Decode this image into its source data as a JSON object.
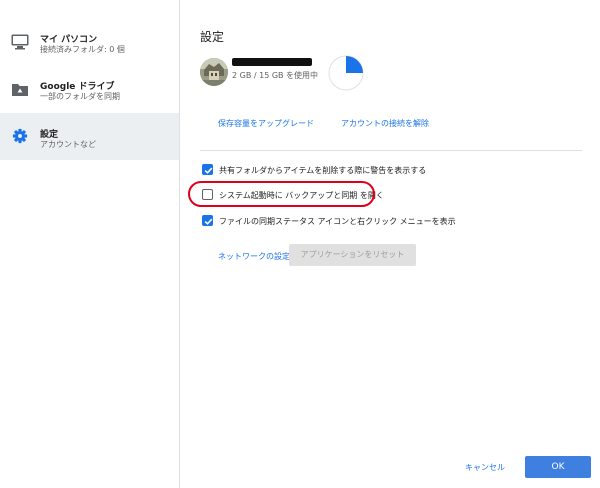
{
  "sidebar": {
    "items": [
      {
        "icon": "monitor-icon",
        "title": "マイ パソコン",
        "subtitle": "接続済みフォルダ: 0 個",
        "active": false
      },
      {
        "icon": "drive-folder-icon",
        "title": "Google ドライブ",
        "subtitle": "一部のフォルダを同期",
        "active": false
      },
      {
        "icon": "gear-icon",
        "title": "設定",
        "subtitle": "アカウントなど",
        "active": true
      }
    ]
  },
  "main": {
    "title": "設定",
    "account": {
      "usage_text": "2 GB / 15 GB を使用中",
      "used_fraction": 0.1333,
      "upgrade_label": "保存容量をアップグレード",
      "disconnect_label": "アカウントの接続を解除"
    },
    "options": [
      {
        "label": "共有フォルダからアイテムを削除する際に警告を表示する",
        "checked": true
      },
      {
        "label": "システム起動時に バックアップと同期 を開く",
        "checked": false
      },
      {
        "label": "ファイルの同期ステータス アイコンと右クリック メニューを表示",
        "checked": true
      }
    ],
    "network_settings_label": "ネットワークの設定",
    "reset_app_label": "アプリケーションをリセット"
  },
  "footer": {
    "cancel_label": "キャンセル",
    "ok_label": "OK"
  },
  "colors": {
    "accent": "#1a73e8",
    "ok_button": "#3f7fe0",
    "active_nav": "#eceff1",
    "highlight": "#e0001b"
  }
}
